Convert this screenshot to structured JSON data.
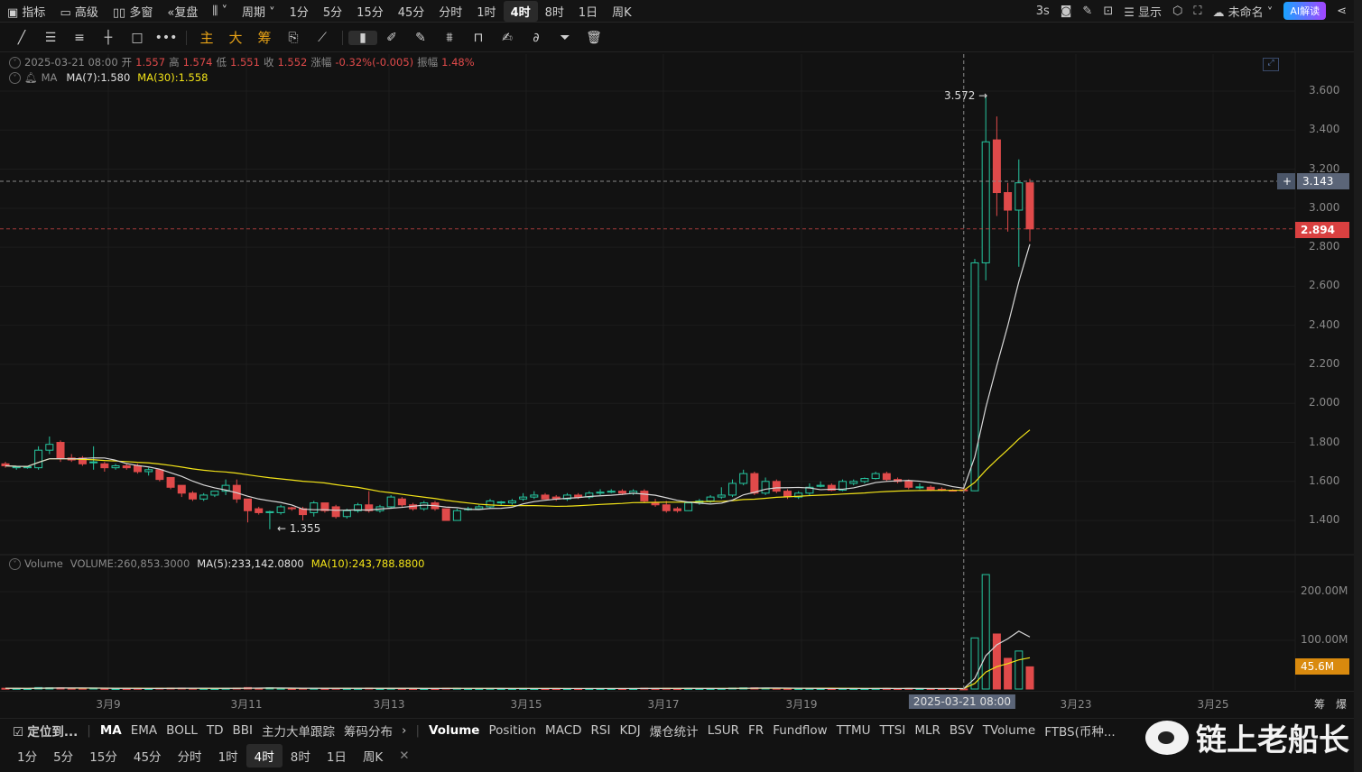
{
  "top_toolbar": {
    "left_items": [
      "指标",
      "高级",
      "多窗",
      "复盘"
    ],
    "chart_type_icon": "candles-icon",
    "period_label": "周期",
    "periods": [
      "1分",
      "5分",
      "15分",
      "45分",
      "分时",
      "1时",
      "4时",
      "8时",
      "1日",
      "周K"
    ],
    "active_period": "4时",
    "refresh": "3s",
    "display_label": "显示",
    "layout_name": "未命名",
    "ai_label": "AI解读"
  },
  "drawing_tools": {
    "text_tools": [
      "主",
      "大",
      "筹"
    ]
  },
  "ohlc_info": {
    "datetime": "2025-03-21 08:00",
    "open_label": "开",
    "open": "1.557",
    "high_label": "高",
    "high": "1.574",
    "low_label": "低",
    "low": "1.551",
    "close_label": "收",
    "close": "1.552",
    "change_label": "涨幅",
    "change": "-0.32%(-0.005)",
    "amp_label": "振幅",
    "amp": "1.48%"
  },
  "ma_info": {
    "label": "MA",
    "ma7": "MA(7):1.580",
    "ma30": "MA(30):1.558"
  },
  "volume_info": {
    "label": "Volume",
    "volume": "VOLUME:260,853.3000",
    "ma5": "MA(5):233,142.0800",
    "ma10": "MA(10):243,788.8800"
  },
  "price_axis": [
    "3.600",
    "3.400",
    "3.200",
    "3.000",
    "2.800",
    "2.600",
    "2.400",
    "2.200",
    "2.000",
    "1.800",
    "1.600",
    "1.400"
  ],
  "volume_axis": [
    "200.00M",
    "100.00M"
  ],
  "crosshair": {
    "price": "3.143",
    "time": "2025-03-21 08:00"
  },
  "last_price": "2.894",
  "last_volume": "45.6M",
  "high_mark": "3.572 →",
  "low_mark": "← 1.355",
  "date_labels": [
    "3月9",
    "3月11",
    "3月13",
    "3月15",
    "3月17",
    "3月19",
    "3月23",
    "3月25"
  ],
  "axis_right_labels": [
    "筹",
    "爆"
  ],
  "indicators": {
    "locate": "定位到...",
    "main": [
      "MA",
      "EMA",
      "BOLL",
      "TD",
      "BBI",
      "主力大单跟踪",
      "筹码分布"
    ],
    "sub": [
      "Volume",
      "Position",
      "MACD",
      "RSI",
      "KDJ",
      "爆仓统计",
      "LSUR",
      "FR",
      "Fundflow",
      "TTMU",
      "TTSI",
      "MLR",
      "BSV",
      "TVolume",
      "FTBS(币种..."
    ]
  },
  "bottom_periods": [
    "1分",
    "5分",
    "15分",
    "45分",
    "分时",
    "1时",
    "4时",
    "8时",
    "1日",
    "周K"
  ],
  "watermark": "链上老船长",
  "colors": {
    "up": "#26c6a0",
    "down": "#e04a4a",
    "ma7": "#d8d8d8",
    "ma30": "#f2e318",
    "accent": "#e8a317"
  },
  "chart_data": {
    "type": "candlestick",
    "interval": "4h",
    "ylim": [
      1.3,
      3.7
    ],
    "volume_unit": "M",
    "candles_ohlcv": [
      [
        1.69,
        1.7,
        1.67,
        1.68,
        1.5
      ],
      [
        1.67,
        1.68,
        1.66,
        1.675,
        1.2
      ],
      [
        1.67,
        1.68,
        1.665,
        1.675,
        1.0
      ],
      [
        1.67,
        1.78,
        1.66,
        1.76,
        3
      ],
      [
        1.76,
        1.83,
        1.74,
        1.79,
        2.5
      ],
      [
        1.8,
        1.81,
        1.7,
        1.72,
        2.5
      ],
      [
        1.72,
        1.74,
        1.7,
        1.71,
        1.5
      ],
      [
        1.72,
        1.73,
        1.68,
        1.69,
        1.5
      ],
      [
        1.7,
        1.78,
        1.66,
        1.7,
        2
      ],
      [
        1.69,
        1.7,
        1.65,
        1.67,
        1.2
      ],
      [
        1.67,
        1.69,
        1.66,
        1.68,
        1
      ],
      [
        1.68,
        1.69,
        1.66,
        1.67,
        1
      ],
      [
        1.68,
        1.69,
        1.64,
        1.65,
        1.3
      ],
      [
        1.65,
        1.67,
        1.63,
        1.66,
        1
      ],
      [
        1.66,
        1.66,
        1.6,
        1.61,
        1.8
      ],
      [
        1.62,
        1.62,
        1.56,
        1.57,
        2
      ],
      [
        1.58,
        1.58,
        1.52,
        1.54,
        2
      ],
      [
        1.54,
        1.55,
        1.5,
        1.51,
        1.5
      ],
      [
        1.51,
        1.54,
        1.5,
        1.53,
        1.2
      ],
      [
        1.53,
        1.55,
        1.52,
        1.55,
        1
      ],
      [
        1.55,
        1.61,
        1.53,
        1.58,
        1.5
      ],
      [
        1.58,
        1.61,
        1.49,
        1.51,
        2
      ],
      [
        1.51,
        1.51,
        1.39,
        1.45,
        3
      ],
      [
        1.46,
        1.47,
        1.43,
        1.44,
        1.5
      ],
      [
        1.44,
        1.45,
        1.355,
        1.445,
        2.5
      ],
      [
        1.44,
        1.48,
        1.43,
        1.47,
        1.5
      ],
      [
        1.465,
        1.47,
        1.45,
        1.46,
        1
      ],
      [
        1.46,
        1.47,
        1.4,
        1.43,
        1.5
      ],
      [
        1.44,
        1.5,
        1.42,
        1.49,
        1.5
      ],
      [
        1.49,
        1.49,
        1.44,
        1.45,
        1.2
      ],
      [
        1.47,
        1.48,
        1.41,
        1.42,
        1.5
      ],
      [
        1.42,
        1.46,
        1.41,
        1.45,
        1.2
      ],
      [
        1.45,
        1.49,
        1.44,
        1.48,
        1.2
      ],
      [
        1.48,
        1.55,
        1.44,
        1.45,
        2
      ],
      [
        1.45,
        1.48,
        1.44,
        1.47,
        1
      ],
      [
        1.47,
        1.53,
        1.46,
        1.52,
        1.5
      ],
      [
        1.51,
        1.52,
        1.47,
        1.48,
        1.2
      ],
      [
        1.48,
        1.49,
        1.45,
        1.46,
        1
      ],
      [
        1.46,
        1.5,
        1.45,
        1.49,
        1
      ],
      [
        1.49,
        1.5,
        1.45,
        1.46,
        1
      ],
      [
        1.46,
        1.46,
        1.4,
        1.4,
        1.8
      ],
      [
        1.4,
        1.46,
        1.4,
        1.45,
        1.5
      ],
      [
        1.455,
        1.47,
        1.45,
        1.46,
        1
      ],
      [
        1.46,
        1.48,
        1.46,
        1.47,
        1
      ],
      [
        1.47,
        1.51,
        1.46,
        1.5,
        1.2
      ],
      [
        1.49,
        1.5,
        1.48,
        1.495,
        1
      ],
      [
        1.49,
        1.51,
        1.48,
        1.5,
        1
      ],
      [
        1.51,
        1.54,
        1.5,
        1.52,
        1.2
      ],
      [
        1.52,
        1.55,
        1.51,
        1.53,
        1
      ],
      [
        1.53,
        1.54,
        1.51,
        1.51,
        1
      ],
      [
        1.52,
        1.53,
        1.5,
        1.51,
        1
      ],
      [
        1.51,
        1.54,
        1.5,
        1.53,
        1
      ],
      [
        1.53,
        1.54,
        1.51,
        1.52,
        1
      ],
      [
        1.52,
        1.55,
        1.51,
        1.54,
        1
      ],
      [
        1.54,
        1.56,
        1.53,
        1.545,
        1
      ],
      [
        1.545,
        1.56,
        1.54,
        1.55,
        1
      ],
      [
        1.55,
        1.56,
        1.53,
        1.54,
        1
      ],
      [
        1.54,
        1.56,
        1.53,
        1.55,
        1
      ],
      [
        1.55,
        1.56,
        1.49,
        1.5,
        1.8
      ],
      [
        1.49,
        1.51,
        1.47,
        1.48,
        1.2
      ],
      [
        1.48,
        1.5,
        1.44,
        1.45,
        1.5
      ],
      [
        1.46,
        1.47,
        1.44,
        1.45,
        1
      ],
      [
        1.45,
        1.49,
        1.45,
        1.49,
        1.2
      ],
      [
        1.49,
        1.51,
        1.48,
        1.5,
        1
      ],
      [
        1.5,
        1.53,
        1.49,
        1.52,
        1
      ],
      [
        1.52,
        1.57,
        1.51,
        1.53,
        1.2
      ],
      [
        1.53,
        1.61,
        1.52,
        1.59,
        2
      ],
      [
        1.59,
        1.66,
        1.58,
        1.64,
        2.5
      ],
      [
        1.64,
        1.65,
        1.53,
        1.54,
        2.5
      ],
      [
        1.54,
        1.62,
        1.53,
        1.6,
        2
      ],
      [
        1.6,
        1.61,
        1.54,
        1.55,
        1.5
      ],
      [
        1.55,
        1.56,
        1.51,
        1.525,
        1.2
      ],
      [
        1.52,
        1.55,
        1.51,
        1.54,
        1
      ],
      [
        1.54,
        1.59,
        1.53,
        1.57,
        1.2
      ],
      [
        1.575,
        1.6,
        1.57,
        1.58,
        1
      ],
      [
        1.58,
        1.59,
        1.55,
        1.555,
        1
      ],
      [
        1.555,
        1.61,
        1.55,
        1.6,
        1.2
      ],
      [
        1.59,
        1.61,
        1.58,
        1.6,
        1
      ],
      [
        1.6,
        1.62,
        1.59,
        1.615,
        1
      ],
      [
        1.615,
        1.65,
        1.61,
        1.64,
        1.2
      ],
      [
        1.64,
        1.65,
        1.6,
        1.61,
        1.2
      ],
      [
        1.61,
        1.62,
        1.59,
        1.6,
        1
      ],
      [
        1.6,
        1.61,
        1.56,
        1.57,
        1.2
      ],
      [
        1.57,
        1.59,
        1.56,
        1.572,
        1
      ],
      [
        1.57,
        1.58,
        1.55,
        1.555,
        1
      ],
      [
        1.56,
        1.57,
        1.55,
        1.555,
        1
      ],
      [
        1.555,
        1.56,
        1.55,
        1.552,
        1
      ],
      [
        1.557,
        1.574,
        1.551,
        1.552,
        0.26
      ],
      [
        1.552,
        2.74,
        1.55,
        2.72,
        105
      ],
      [
        2.72,
        3.572,
        2.63,
        3.34,
        235
      ],
      [
        3.35,
        3.47,
        2.96,
        3.08,
        113
      ],
      [
        3.08,
        3.13,
        2.88,
        2.99,
        63
      ],
      [
        2.99,
        3.25,
        2.7,
        3.13,
        78
      ],
      [
        3.13,
        3.15,
        2.83,
        2.894,
        45.6
      ]
    ],
    "series": [
      {
        "name": "MA(7)"
      },
      {
        "name": "MA(30)"
      }
    ],
    "volume_series": [
      {
        "name": "MA(5)"
      },
      {
        "name": "MA(10)"
      }
    ]
  }
}
